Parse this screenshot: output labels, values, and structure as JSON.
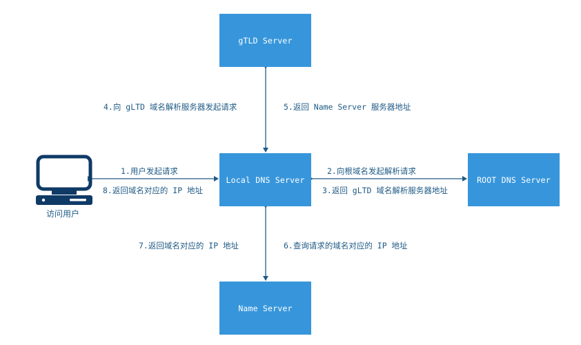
{
  "colors": {
    "box_fill": "#3796DB",
    "box_text": "#FFFFFF",
    "line": "#1F5A85",
    "label": "#1F5A85",
    "icon": "#0F3A66"
  },
  "nodes": {
    "gtld": "gTLD Server",
    "local": "Local DNS Server",
    "root": "ROOT DNS Server",
    "name": "Name Server",
    "user": "访问用户"
  },
  "icons": {
    "user": "computer-monitor-icon"
  },
  "edges": {
    "step1": "1.用户发起请求",
    "step2": "2.向根域名发起解析请求",
    "step3": "3.返回 gLTD 域名解析服务器地址",
    "step4": "4.向 gLTD 域名解析服务器发起请求",
    "step5": "5.返回 Name Server 服务器地址",
    "step6": "6.查询请求的域名对应的 IP 地址",
    "step7": "7.返回域名对应的 IP 地址",
    "step8": "8.返回域名对应的 IP 地址"
  }
}
